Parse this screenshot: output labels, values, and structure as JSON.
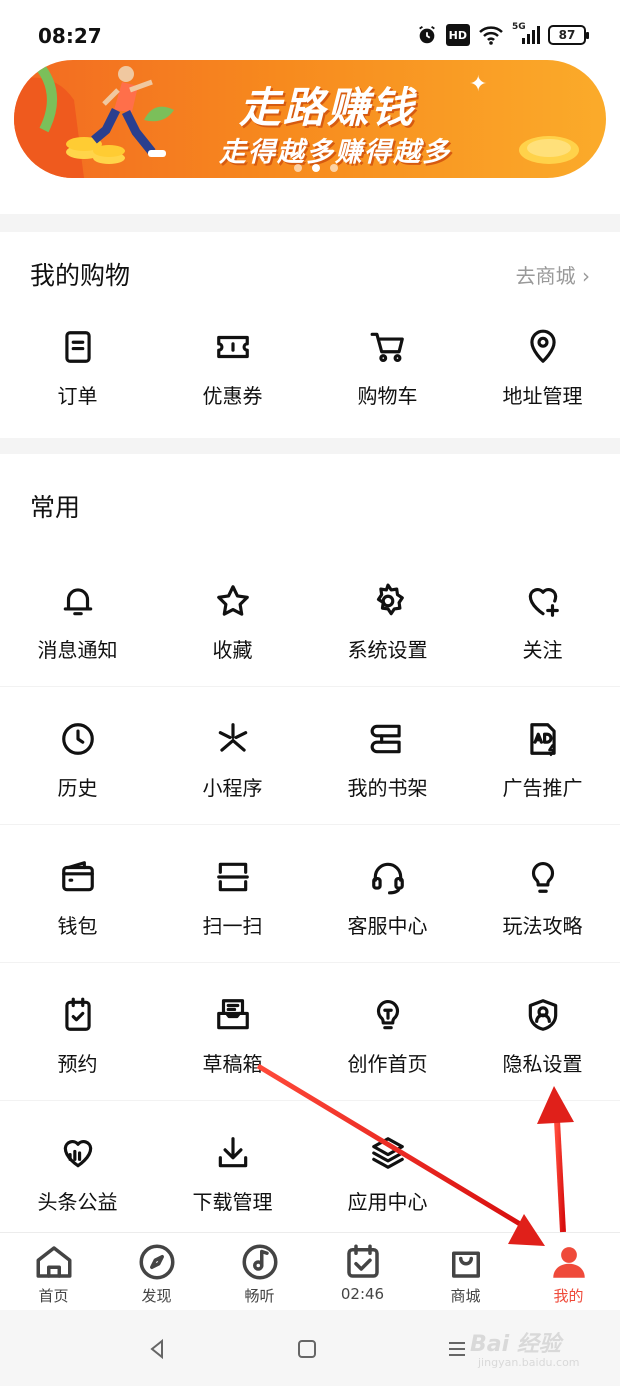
{
  "status": {
    "time": "08:27",
    "hd": "HD",
    "network": "5G",
    "battery": "87"
  },
  "banner": {
    "title": "走路赚钱",
    "subtitle": "走得越多赚得越多"
  },
  "shopping": {
    "title": "我的购物",
    "link": "去商城 ›",
    "items": [
      {
        "label": "订单",
        "icon": "order-icon"
      },
      {
        "label": "优惠券",
        "icon": "coupon-icon"
      },
      {
        "label": "购物车",
        "icon": "cart-icon"
      },
      {
        "label": "地址管理",
        "icon": "location-icon"
      }
    ]
  },
  "common": {
    "title": "常用",
    "items": [
      {
        "label": "消息通知",
        "icon": "bell-icon"
      },
      {
        "label": "收藏",
        "icon": "star-icon"
      },
      {
        "label": "系统设置",
        "icon": "gear-icon"
      },
      {
        "label": "关注",
        "icon": "heart-plus-icon"
      },
      {
        "label": "历史",
        "icon": "clock-icon"
      },
      {
        "label": "小程序",
        "icon": "mini-program-icon"
      },
      {
        "label": "我的书架",
        "icon": "bookshelf-icon"
      },
      {
        "label": "广告推广",
        "icon": "ad-icon"
      },
      {
        "label": "钱包",
        "icon": "wallet-icon"
      },
      {
        "label": "扫一扫",
        "icon": "scan-icon"
      },
      {
        "label": "客服中心",
        "icon": "headset-icon"
      },
      {
        "label": "玩法攻略",
        "icon": "lightbulb-icon"
      },
      {
        "label": "预约",
        "icon": "clipboard-check-icon"
      },
      {
        "label": "草稿箱",
        "icon": "draft-box-icon"
      },
      {
        "label": "创作首页",
        "icon": "create-bulb-icon"
      },
      {
        "label": "隐私设置",
        "icon": "privacy-shield-icon"
      },
      {
        "label": "头条公益",
        "icon": "charity-heart-icon"
      },
      {
        "label": "下载管理",
        "icon": "download-icon"
      },
      {
        "label": "应用中心",
        "icon": "layers-icon"
      }
    ]
  },
  "tabbar": {
    "items": [
      {
        "label": "首页",
        "icon": "home-icon"
      },
      {
        "label": "发现",
        "icon": "compass-icon"
      },
      {
        "label": "畅听",
        "icon": "music-disc-icon"
      },
      {
        "label": "02:46",
        "icon": "calendar-check-icon"
      },
      {
        "label": "商城",
        "icon": "shopping-bag-icon"
      },
      {
        "label": "我的",
        "icon": "person-icon"
      }
    ],
    "active_index": 5,
    "active_color": "#ef4a3a"
  },
  "watermark": {
    "text": "Bai 经验",
    "sub": "jingyan.baidu.com"
  }
}
